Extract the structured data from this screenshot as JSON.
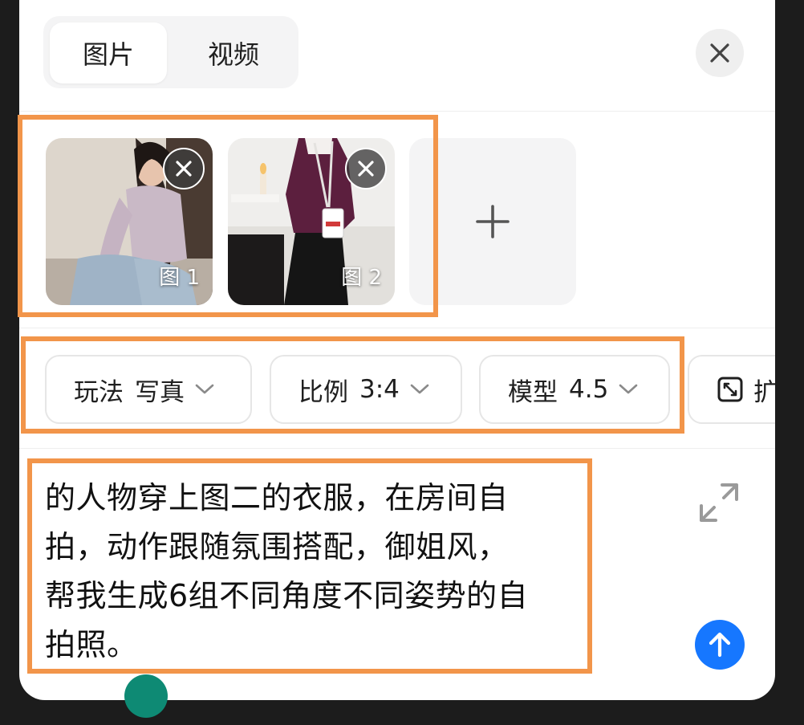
{
  "tabs": [
    {
      "label": "图片",
      "active": true
    },
    {
      "label": "视频",
      "active": false
    }
  ],
  "icons": {
    "close": "close-icon",
    "remove": "remove-image-icon",
    "add": "plus-icon",
    "chevron": "chevron-down-icon",
    "expand": "expand-icon",
    "send": "arrow-up-icon",
    "resize": "resize-frame-icon"
  },
  "images": [
    {
      "caption": "图 1"
    },
    {
      "caption": "图 2"
    }
  ],
  "options": [
    {
      "label": "玩法",
      "value": "写真"
    },
    {
      "label": "比例",
      "value": "3:4"
    },
    {
      "label": "模型",
      "value": "4.5"
    },
    {
      "label": "扩"
    }
  ],
  "prompt": {
    "lines": [
      "的人物穿上图二的衣服，在房间自",
      "拍，动作跟随氛围搭配，御姐风，",
      "帮我生成6组不同角度不同姿势的自",
      "拍照。"
    ]
  },
  "colors": {
    "accent": "#1677ff",
    "highlight": "#f2954a",
    "chip_border": "#e6e6e6",
    "tab_bg": "#f4f4f5"
  }
}
